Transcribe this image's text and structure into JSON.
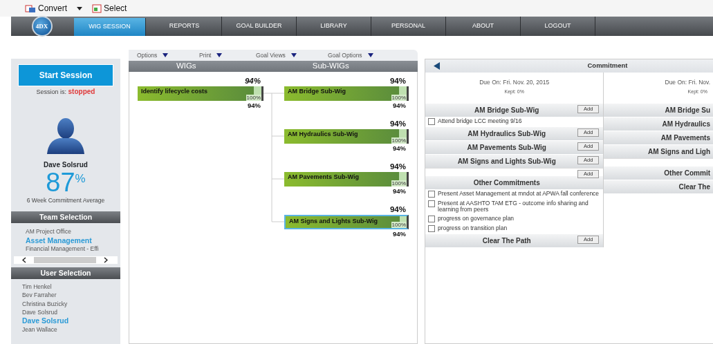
{
  "toolbar": {
    "buttons": [
      {
        "label": "Convert",
        "kind": "convert",
        "has_menu": true
      },
      {
        "label": "Select",
        "kind": "select",
        "has_menu": false
      }
    ]
  },
  "nav": {
    "logo_text": "4DX",
    "tabs": [
      {
        "label": "WIG SESSION",
        "selected": true
      },
      {
        "label": "REPORTS",
        "selected": false
      },
      {
        "label": "GOAL BUILDER",
        "selected": false
      },
      {
        "label": "LIBRARY",
        "selected": false
      },
      {
        "label": "PERSONAL",
        "selected": false
      },
      {
        "label": "ABOUT",
        "selected": false
      },
      {
        "label": "LOGOUT",
        "selected": false
      }
    ]
  },
  "sidebar": {
    "start_button": "Start Session",
    "session_label": "Session is:",
    "session_state": "stopped",
    "user_name": "Dave Solsrud",
    "score": "87",
    "score_unit": "%",
    "score_caption": "6 Week Commitment Average",
    "team_header": "Team Selection",
    "teams": [
      {
        "name": "AM Project Office",
        "selected": false
      },
      {
        "name": "Asset Management",
        "selected": true
      },
      {
        "name": "Financial Management - Effi",
        "selected": false
      }
    ],
    "user_header": "User Selection",
    "users": [
      {
        "name": "Tim Henkel",
        "selected": false
      },
      {
        "name": "Bev Farraher",
        "selected": false
      },
      {
        "name": "Christina Buzicky",
        "selected": false
      },
      {
        "name": "Dave Solsrud",
        "selected": false
      },
      {
        "name": "Dave Solsrud",
        "selected": true
      },
      {
        "name": "Jean Wallace",
        "selected": false
      }
    ]
  },
  "wig_toolbar": {
    "menus": [
      "Options",
      "Print",
      "Goal Views",
      "Goal Options"
    ]
  },
  "wig_tree": {
    "headers": [
      "WIGs",
      "Sub-WIGs"
    ],
    "wig": {
      "name": "Identify lifecycle costs",
      "top_value": "94%",
      "target": "100%",
      "bottom_value": "94%",
      "level": 0.94,
      "selected": false,
      "children": [
        {
          "name": "AM Bridge Sub-Wig",
          "top_value": "94%",
          "target": "100%",
          "bottom_value": "94%",
          "level": 0.94,
          "selected": false
        },
        {
          "name": "AM Hydraulics Sub-Wig",
          "top_value": "94%",
          "target": "100%",
          "bottom_value": "94%",
          "level": 0.94,
          "selected": false
        },
        {
          "name": "AM Pavements Sub-Wig",
          "top_value": "94%",
          "target": "100%",
          "bottom_value": "94%",
          "level": 0.94,
          "selected": false
        },
        {
          "name": "AM Signs and Lights Sub-Wig",
          "top_value": "94%",
          "target": "100%",
          "bottom_value": "94%",
          "level": 0.94,
          "selected": true
        }
      ]
    }
  },
  "commitment": {
    "title": "Commitment",
    "columns": [
      {
        "due": "Due On: Fri. Nov. 20, 2015",
        "kept": "Kept: 0%",
        "sections": [
          {
            "title": "AM Bridge Sub-Wig",
            "add": "Add",
            "gap_before": false,
            "items": [
              {
                "text": "Attend bridge LCC meeting 9/16",
                "checked": false
              }
            ]
          },
          {
            "title": "AM Hydraulics Sub-Wig",
            "add": "Add",
            "gap_before": false
          },
          {
            "title": "AM Pavements Sub-Wig",
            "add": "Add",
            "gap_before": false
          },
          {
            "title": "AM Signs and Lights Sub-Wig",
            "add": "Add",
            "gap_before": false
          },
          {
            "title": "Other Commitments",
            "add": "Add",
            "gap_before": true,
            "items": [
              {
                "text": "Present Asset Management at mndot at APWA fall conference",
                "checked": false
              },
              {
                "text": "Present at AASHTO TAM ETG - outcome info sharing and learning from peers",
                "checked": false
              },
              {
                "text": "progress on governance plan",
                "checked": false
              },
              {
                "text": "progress on transition plan",
                "checked": false
              }
            ]
          },
          {
            "title": "Clear The Path",
            "add": "Add",
            "gap_before": false
          }
        ]
      },
      {
        "due": "Due On: Fri. Nov.",
        "kept": "Kept: 0%",
        "sections": [
          {
            "title": "AM Bridge Su",
            "gap_before": false
          },
          {
            "title": "AM Hydraulics",
            "gap_before": false
          },
          {
            "title": "AM Pavements",
            "gap_before": false
          },
          {
            "title": "AM Signs and Ligh",
            "gap_before": false
          },
          {
            "title": "Other Commit",
            "gap_before": true
          },
          {
            "title": "Clear The",
            "gap_before": false
          }
        ]
      }
    ]
  }
}
